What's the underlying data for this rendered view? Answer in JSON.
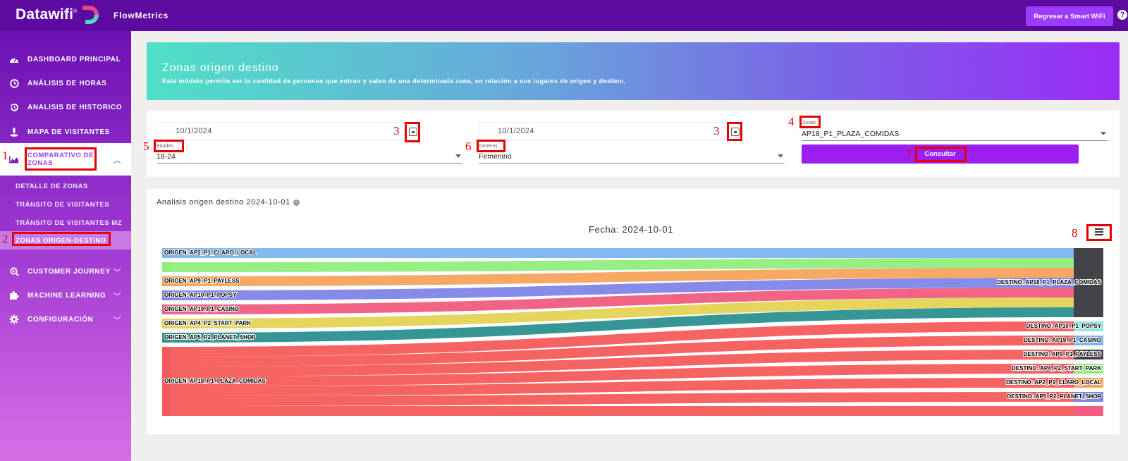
{
  "topbar": {
    "logo_text": "Datawifi",
    "logo_reg": "®",
    "app_name": "FlowMetrics",
    "back_button": "Regresar a Smart WiFi",
    "help": "?"
  },
  "sidebar": {
    "items": [
      {
        "label": "DASHBOARD PRINCIPAL",
        "icon": "gauge-icon"
      },
      {
        "label": "ANÁLISIS DE HORAS",
        "icon": "clock-icon"
      },
      {
        "label": "ANALISIS DE HISTORICO",
        "icon": "history-icon"
      },
      {
        "label": "MAPA DE VISITANTES",
        "icon": "map-pin-icon"
      },
      {
        "label": "COMPARATIVO DE ZONAS",
        "icon": "area-chart-icon"
      },
      {
        "label": "CUSTOMER JOURNEY",
        "icon": "search-icon"
      },
      {
        "label": "MACHINE LEARNING",
        "icon": "puzzle-icon"
      },
      {
        "label": "CONFIGURACIÓN",
        "icon": "gear-icon"
      }
    ],
    "sub_items": [
      {
        "label": "DETALLE DE ZONAS"
      },
      {
        "label": "TRÁNSITO DE VISITANTES"
      },
      {
        "label": "TRÁNSITO DE VISITANTES MZ"
      },
      {
        "label": "ZONAS ORIGEN-DESTINO"
      }
    ]
  },
  "hero": {
    "title": "Zonas origen destino",
    "description": "Este módulo permite ver la cantidad de personas que entran y salen de una determinada zona, en relación a sus lugares de origen y destino."
  },
  "filters": {
    "start_date": "10/1/2024",
    "end_date": "10/1/2024",
    "zonas_label": "Zonas",
    "zonas_value": "AP18_P1_PLAZA_COMIDAS",
    "edades_label": "Edades",
    "edades_value": "18-24",
    "generos_label": "Generos",
    "generos_value": "Femenino",
    "consultar": "Consultar"
  },
  "annotations": [
    "1",
    "2",
    "3",
    "3",
    "4",
    "5",
    "6",
    "7",
    "8"
  ],
  "section": {
    "title": "Analisis origen destino 2024-10-01",
    "info": "i"
  },
  "chart_data": {
    "type": "sankey",
    "title": "Fecha: 2024-10-01",
    "sources": [
      {
        "name": "ORIGEN: AP2_P1_CLARO_LOCAL",
        "value": 1,
        "color": "#7cb5ec"
      },
      {
        "name": "",
        "value": 1,
        "color": "#90ed7d"
      },
      {
        "name": "ORIGEN: AP9_P1_PAYLESS",
        "value": 1,
        "color": "#f7a35c"
      },
      {
        "name": "ORIGEN: AP10_P1_POPSY",
        "value": 1,
        "color": "#8085e9"
      },
      {
        "name": "ORIGEN: AP19_P1_CASINO",
        "value": 1,
        "color": "#f15c80"
      },
      {
        "name": "ORIGEN: AP4_P2_START_PARK",
        "value": 1,
        "color": "#e4d354"
      },
      {
        "name": "ORIGEN: AP5_P2_PLANET_SHOP",
        "value": 1,
        "color": "#2b908f"
      },
      {
        "name": "ORIGEN: AP18_P1_PLAZA_COMIDAS",
        "value": 7,
        "color": "#f45b5b"
      }
    ],
    "targets": [
      {
        "name": "DESTINO: AP18_P1_PLAZA_COMIDAS",
        "value": 7,
        "color": "#434348"
      },
      {
        "name": "DESTINO: AP10_P1_POPSY",
        "value": 1,
        "color": "#91e8e1"
      },
      {
        "name": "DESTINO: AP19_P1_CASINO",
        "value": 1,
        "color": "#7cb5ec"
      },
      {
        "name": "DESTINO: AP9_P1_PAYLESS",
        "value": 1,
        "color": "#434348"
      },
      {
        "name": "DESTINO: AP4_P2_START_PARK",
        "value": 1,
        "color": "#90ed7d"
      },
      {
        "name": "DESTINO: AP2_P1_CLARO_LOCAL",
        "value": 1,
        "color": "#f7a35c"
      },
      {
        "name": "DESTINO: AP5_P2_PLANET_SHOP",
        "value": 1,
        "color": "#8085e9"
      },
      {
        "name": "",
        "value": 1,
        "color": "#f15c80"
      }
    ],
    "links": [
      {
        "from": 0,
        "to": 0,
        "value": 1
      },
      {
        "from": 1,
        "to": 0,
        "value": 1
      },
      {
        "from": 2,
        "to": 0,
        "value": 1
      },
      {
        "from": 3,
        "to": 0,
        "value": 1
      },
      {
        "from": 4,
        "to": 0,
        "value": 1
      },
      {
        "from": 5,
        "to": 0,
        "value": 1
      },
      {
        "from": 6,
        "to": 0,
        "value": 1
      },
      {
        "from": 7,
        "to": 1,
        "value": 1
      },
      {
        "from": 7,
        "to": 2,
        "value": 1
      },
      {
        "from": 7,
        "to": 3,
        "value": 1
      },
      {
        "from": 7,
        "to": 4,
        "value": 1
      },
      {
        "from": 7,
        "to": 5,
        "value": 1
      },
      {
        "from": 7,
        "to": 6,
        "value": 1
      },
      {
        "from": 7,
        "to": 7,
        "value": 1
      }
    ]
  }
}
